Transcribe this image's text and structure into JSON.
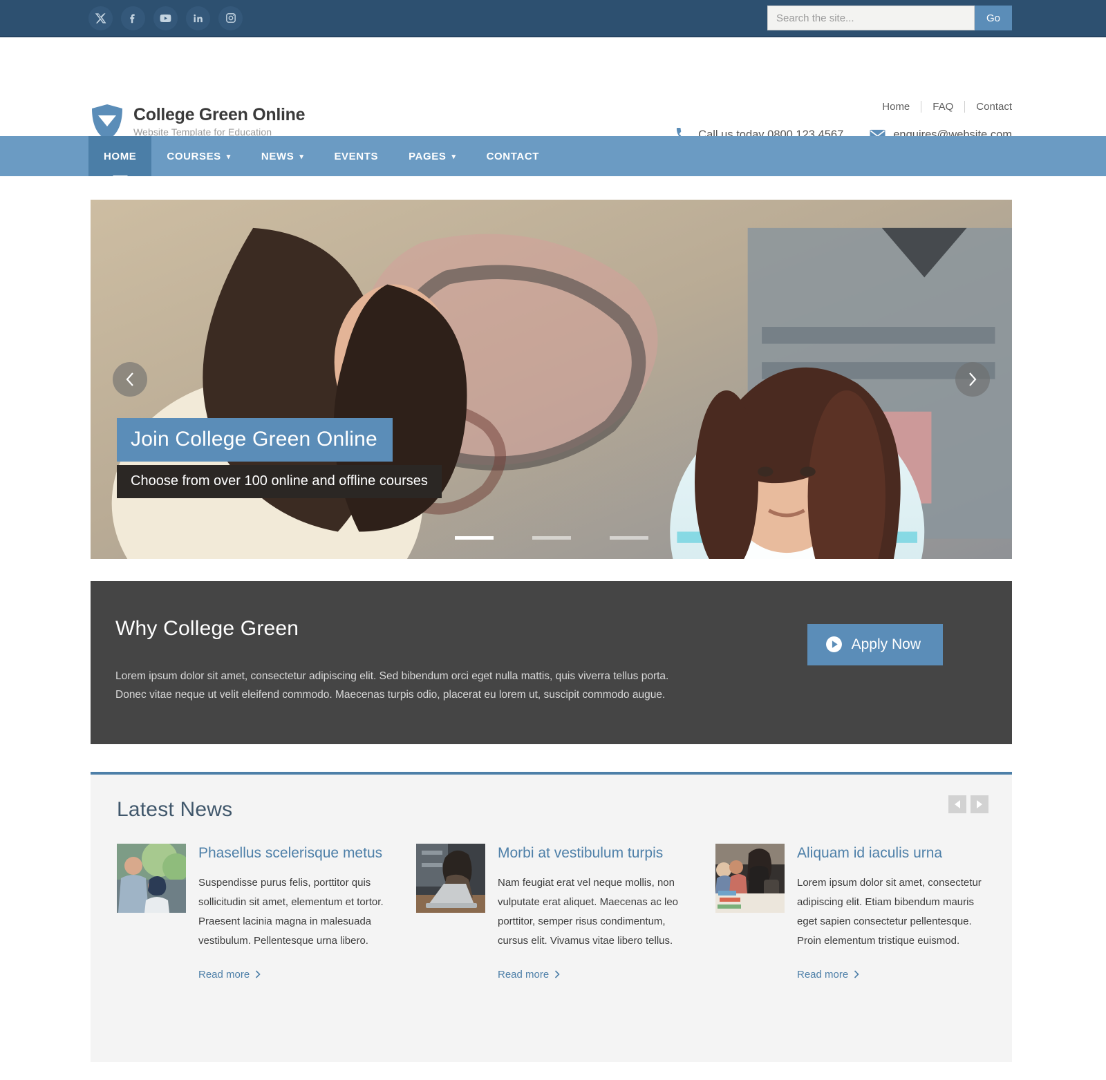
{
  "topbar": {
    "social": [
      {
        "name": "twitter-x-icon",
        "label": "X"
      },
      {
        "name": "facebook-icon",
        "label": "Facebook"
      },
      {
        "name": "youtube-icon",
        "label": "YouTube"
      },
      {
        "name": "linkedin-icon",
        "label": "LinkedIn"
      },
      {
        "name": "instagram-icon",
        "label": "Instagram"
      }
    ],
    "search": {
      "placeholder": "Search the site...",
      "value": "",
      "button_label": "Go"
    },
    "colors": {
      "background": "#2d5070",
      "icon_circle": "#34587a",
      "go_button": "#5b8db8"
    }
  },
  "header": {
    "logo": {
      "title": "College Green Online",
      "tagline": "Website Template for Education",
      "icon": "shield-icon",
      "color": "#5b8db8"
    },
    "util_links": [
      "Home",
      "FAQ",
      "Contact"
    ],
    "phone": "Call us today 0800 123 4567",
    "email": "enquires@website.com"
  },
  "nav": {
    "background": "#6b9bc3",
    "active_background": "#4b7ea7",
    "items": [
      {
        "label": "HOME",
        "active": true,
        "dropdown": false
      },
      {
        "label": "COURSES",
        "active": false,
        "dropdown": true
      },
      {
        "label": "NEWS",
        "active": false,
        "dropdown": true
      },
      {
        "label": "EVENTS",
        "active": false,
        "dropdown": false
      },
      {
        "label": "PAGES",
        "active": false,
        "dropdown": true
      },
      {
        "label": "CONTACT",
        "active": false,
        "dropdown": false
      }
    ]
  },
  "hero": {
    "title": "Join College Green Online",
    "subtitle": "Choose from over 100 online and offline courses",
    "prev_icon": "chevron-left-icon",
    "next_icon": "chevron-right-icon",
    "slides_total": 3,
    "active_slide": 1,
    "title_bg": "#5b8db8",
    "subtitle_bg": "#2b2724"
  },
  "why": {
    "title": "Why College Green",
    "paragraph_1": "Lorem ipsum dolor sit amet, consectetur adipiscing elit. Sed bibendum orci eget nulla mattis, quis viverra tellus porta.",
    "paragraph_2": "Donec vitae neque ut velit eleifend commodo. Maecenas turpis odio, placerat eu lorem ut, suscipit commodo augue.",
    "cta_label": "Apply Now",
    "cta_icon": "play-circle-icon",
    "background": "#454545",
    "cta_background": "#5b8db8"
  },
  "news": {
    "title": "Latest News",
    "accent_color": "#4d7fa8",
    "prev_icon": "triangle-left-icon",
    "next_icon": "triangle-right-icon",
    "read_more_label": "Read more",
    "read_more_icon": "chevron-right-icon",
    "items": [
      {
        "title": "Phasellus scelerisque metus",
        "text": "Suspendisse purus felis, porttitor quis sollicitudin sit amet, elementum et tortor. Praesent lacinia magna in malesuada vestibulum. Pellentesque urna libero.",
        "thumb": "people-outdoors-photo"
      },
      {
        "title": "Morbi at vestibulum turpis",
        "text": "Nam feugiat erat vel neque mollis, non vulputate erat aliquet. Maecenas ac leo porttitor, semper risus condimentum, cursus elit. Vivamus vitae libero tellus.",
        "thumb": "woman-with-laptop-photo"
      },
      {
        "title": "Aliquam id iaculis urna",
        "text": "Lorem ipsum dolor sit amet, consectetur adipiscing elit. Etiam bibendum mauris eget sapien consectetur pellentesque. Proin elementum tristique euismod.",
        "thumb": "book-market-photo"
      }
    ]
  }
}
